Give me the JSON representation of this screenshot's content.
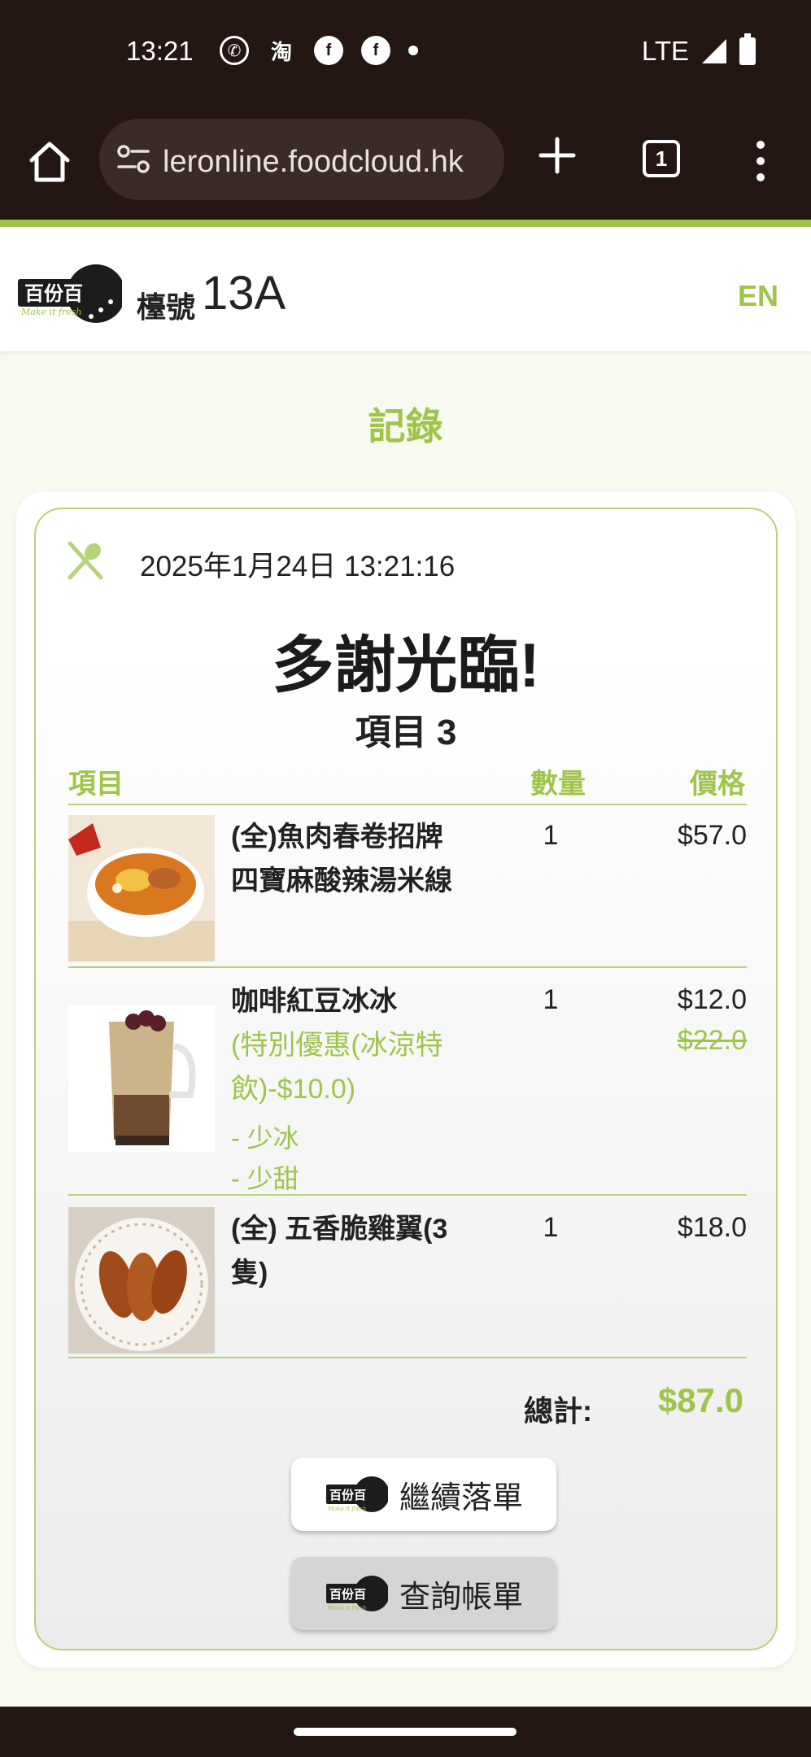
{
  "status_bar": {
    "time": "13:21",
    "network": "LTE",
    "notification_icons": [
      "whatsapp-icon",
      "taobao-icon",
      "facebook-icon",
      "facebook-icon",
      "more-dot-icon"
    ],
    "taobao_glyph": "淘"
  },
  "browser": {
    "url": "leronline.foodcloud.hk",
    "tab_count": "1"
  },
  "header": {
    "table_label": "檯號",
    "table_number": "13A",
    "language_button": "EN"
  },
  "page": {
    "title": "記錄"
  },
  "receipt": {
    "datetime": "2025年1月24日 13:21:16",
    "thanks": "多謝光臨!",
    "item_count": "項目 3",
    "columns": [
      "項目",
      "數量",
      "價格"
    ],
    "items": [
      {
        "name": "(全)魚肉春卷招牌四寶麻酸辣湯米線",
        "qty": "1",
        "price": "$57.0"
      },
      {
        "name": "咖啡紅豆冰冰",
        "option": "(特別優惠(冰涼特飲)-$10.0)",
        "modifiers": [
          "- 少冰",
          "- 少甜"
        ],
        "qty": "1",
        "price": "$12.0",
        "original_price": "$22.0"
      },
      {
        "name": "(全) 五香脆雞翼(3隻)",
        "qty": "1",
        "price": "$18.0"
      }
    ],
    "total_label": "總計:",
    "total_value": "$87.0"
  },
  "buttons": {
    "continue_order": "繼續落單",
    "check_bill": "查詢帳單"
  },
  "colors": {
    "accent": "#9fc44a",
    "system_bar": "#231613"
  }
}
